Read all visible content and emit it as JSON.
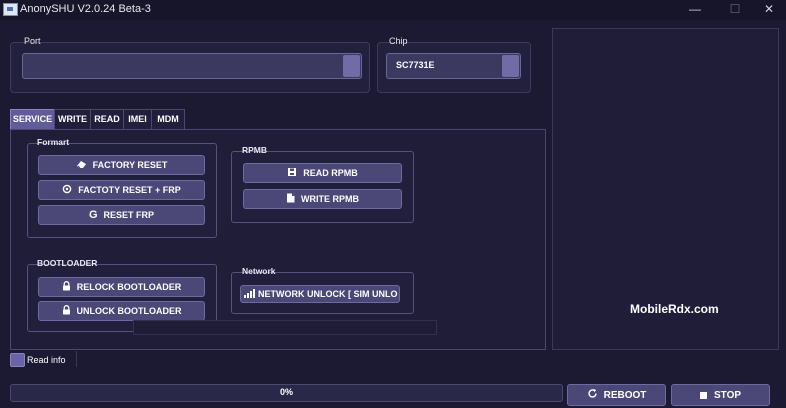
{
  "window": {
    "title": "AnonySHU V2.0.24 Beta-3",
    "minimize": "—",
    "maximize": "☐",
    "close": "✕"
  },
  "port": {
    "label": "Port",
    "value": ""
  },
  "chip": {
    "label": "Chip",
    "value": "SC7731E"
  },
  "tabs": [
    {
      "label": "SERVICE",
      "active": true
    },
    {
      "label": "WRITE"
    },
    {
      "label": "READ"
    },
    {
      "label": "IMEI"
    },
    {
      "label": "MDM"
    }
  ],
  "formart": {
    "label": "Formart",
    "buttons": [
      {
        "label": "FACTORY RESET",
        "icon": "eraser-icon"
      },
      {
        "label": "FACTOTY RESET + FRP",
        "icon": "reset-icon"
      },
      {
        "label": "RESET FRP",
        "icon": "google-icon"
      }
    ]
  },
  "rpmb": {
    "label": "RPMB",
    "buttons": [
      {
        "label": "READ RPMB",
        "icon": "save-icon"
      },
      {
        "label": "WRITE RPMB",
        "icon": "file-icon"
      }
    ]
  },
  "bootloader": {
    "label": "BOOTLOADER",
    "buttons": [
      {
        "label": "RELOCK BOOTLOADER",
        "icon": "lock-icon"
      },
      {
        "label": "UNLOCK BOOTLOADER",
        "icon": "lock-icon"
      }
    ]
  },
  "network": {
    "label": "Network",
    "buttons": [
      {
        "label": "NETWORK UNLOCK [ SIM UNLO",
        "icon": "signal-icon"
      }
    ]
  },
  "read_info": {
    "label": "Read info",
    "checked": true
  },
  "watermark": "MobileRdx.com",
  "progress": {
    "value": 0,
    "text": "0%"
  },
  "actions": {
    "reboot": "REBOOT",
    "stop": "STOP"
  },
  "colors": {
    "background": "#1c1a33",
    "button": "#4b4777",
    "accent": "#625b9a"
  }
}
